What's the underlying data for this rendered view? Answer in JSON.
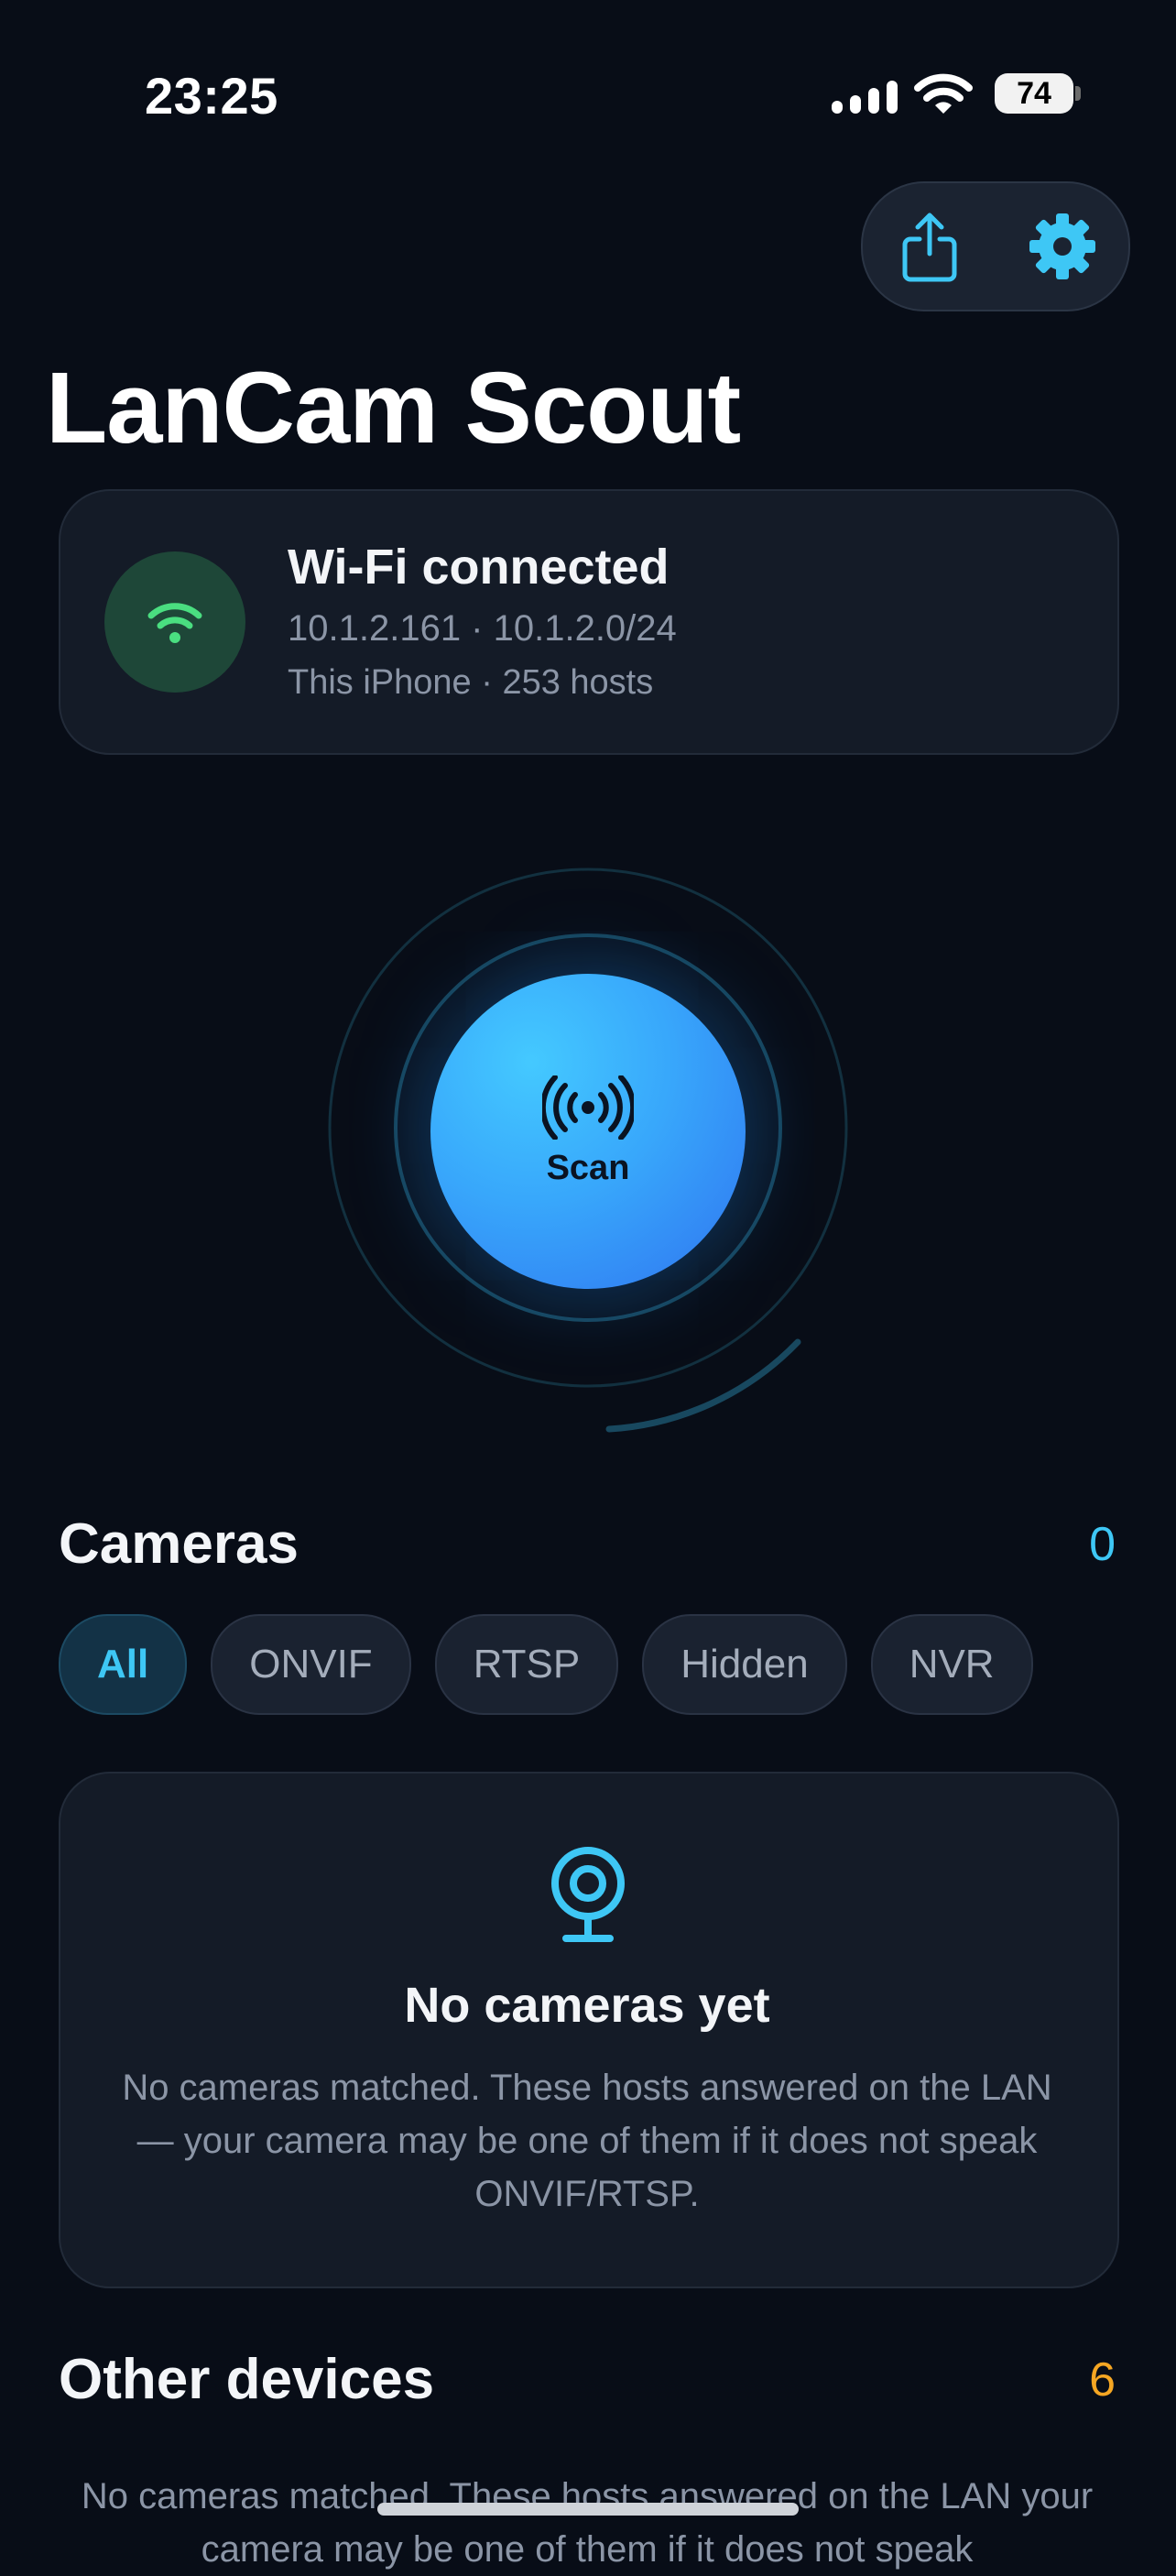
{
  "status_bar": {
    "time": "23:25",
    "battery": "74"
  },
  "header": {
    "title": "LanCam Scout",
    "share_icon": "share-icon",
    "settings_icon": "gear-icon"
  },
  "network": {
    "icon": "wifi-icon",
    "title": "Wi-Fi connected",
    "address": "10.1.2.161 · 10.1.2.0/24",
    "detail": "This iPhone · 253 hosts"
  },
  "scan": {
    "label": "Scan",
    "icon": "broadcast-icon"
  },
  "cameras": {
    "title": "Cameras",
    "count": "0",
    "filters": [
      "All",
      "ONVIF",
      "RTSP",
      "Hidden",
      "NVR"
    ],
    "active_filter": "All",
    "empty": {
      "icon": "webcam-icon",
      "title": "No cameras yet",
      "text": "No cameras matched. These hosts answered on the LAN — your camera may be one of them if it does not speak ONVIF/RTSP."
    }
  },
  "other_devices": {
    "title": "Other devices",
    "count": "6",
    "text": "No cameras matched. These hosts answered on the LAN your camera may be one of them if it does not speak"
  },
  "colors": {
    "accent": "#3ec7f5",
    "warning": "#f5a623",
    "success": "#4ade80",
    "background": "#080d17"
  }
}
